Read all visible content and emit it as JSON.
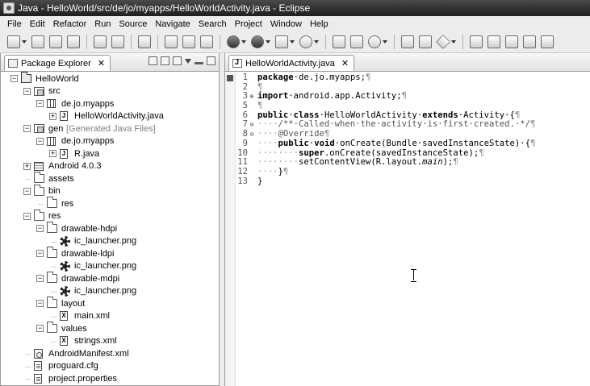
{
  "window": {
    "title": "Java - HelloWorld/src/de/jo/myapps/HelloWorldActivity.java - Eclipse"
  },
  "menu": [
    "File",
    "Edit",
    "Refactor",
    "Run",
    "Source",
    "Navigate",
    "Search",
    "Project",
    "Window",
    "Help"
  ],
  "package_explorer": {
    "tab_label": "Package Explorer",
    "close_glyph": "✕",
    "tree": [
      {
        "label": "HelloWorld",
        "suffix": "",
        "depth": 0,
        "exp": "open",
        "icon": "project"
      },
      {
        "label": "src",
        "suffix": "",
        "depth": 1,
        "exp": "open",
        "icon": "srcfolder"
      },
      {
        "label": "de.jo.myapps",
        "suffix": "",
        "depth": 2,
        "exp": "open",
        "icon": "package"
      },
      {
        "label": "HelloWorldActivity.java",
        "suffix": "",
        "depth": 3,
        "exp": "closed",
        "icon": "java"
      },
      {
        "label": "gen",
        "suffix": "[Generated Java Files]",
        "depth": 1,
        "exp": "open",
        "icon": "srcfolder"
      },
      {
        "label": "de.jo.myapps",
        "suffix": "",
        "depth": 2,
        "exp": "open",
        "icon": "package"
      },
      {
        "label": "R.java",
        "suffix": "",
        "depth": 3,
        "exp": "closed",
        "icon": "java"
      },
      {
        "label": "Android 4.0.3",
        "suffix": "",
        "depth": 1,
        "exp": "closed",
        "icon": "lib"
      },
      {
        "label": "assets",
        "suffix": "",
        "depth": 1,
        "exp": "none",
        "icon": "folder"
      },
      {
        "label": "bin",
        "suffix": "",
        "depth": 1,
        "exp": "open",
        "icon": "folder"
      },
      {
        "label": "res",
        "suffix": "",
        "depth": 2,
        "exp": "none",
        "icon": "folder"
      },
      {
        "label": "res",
        "suffix": "",
        "depth": 1,
        "exp": "open",
        "icon": "folder"
      },
      {
        "label": "drawable-hdpi",
        "suffix": "",
        "depth": 2,
        "exp": "open",
        "icon": "folder"
      },
      {
        "label": "ic_launcher.png",
        "suffix": "",
        "depth": 3,
        "exp": "none",
        "icon": "png"
      },
      {
        "label": "drawable-ldpi",
        "suffix": "",
        "depth": 2,
        "exp": "open",
        "icon": "folder"
      },
      {
        "label": "ic_launcher.png",
        "suffix": "",
        "depth": 3,
        "exp": "none",
        "icon": "png"
      },
      {
        "label": "drawable-mdpi",
        "suffix": "",
        "depth": 2,
        "exp": "open",
        "icon": "folder"
      },
      {
        "label": "ic_launcher.png",
        "suffix": "",
        "depth": 3,
        "exp": "none",
        "icon": "png"
      },
      {
        "label": "layout",
        "suffix": "",
        "depth": 2,
        "exp": "open",
        "icon": "folder"
      },
      {
        "label": "main.xml",
        "suffix": "",
        "depth": 3,
        "exp": "none",
        "icon": "xml"
      },
      {
        "label": "values",
        "suffix": "",
        "depth": 2,
        "exp": "open",
        "icon": "folder"
      },
      {
        "label": "strings.xml",
        "suffix": "",
        "depth": 3,
        "exp": "none",
        "icon": "xml"
      },
      {
        "label": "AndroidManifest.xml",
        "suffix": "",
        "depth": 1,
        "exp": "none",
        "icon": "manifest"
      },
      {
        "label": "proguard.cfg",
        "suffix": "",
        "depth": 1,
        "exp": "none",
        "icon": "file"
      },
      {
        "label": "project.properties",
        "suffix": "",
        "depth": 1,
        "exp": "none",
        "icon": "file"
      }
    ]
  },
  "editor": {
    "tab_label": "HelloWorldActivity.java",
    "close_glyph": "✕",
    "lines": [
      {
        "n": "1",
        "fold": "",
        "segs": [
          [
            "kw",
            "package"
          ],
          [
            "",
            "·de.jo.myapps;"
          ],
          [
            "ws",
            "¶"
          ]
        ]
      },
      {
        "n": "2",
        "fold": "",
        "segs": [
          [
            "ws",
            "¶"
          ]
        ]
      },
      {
        "n": "3",
        "fold": "⊕",
        "segs": [
          [
            "kw",
            "import"
          ],
          [
            "",
            "·android.app.Activity;"
          ],
          [
            "ws",
            "¶"
          ]
        ]
      },
      {
        "n": "5",
        "fold": "",
        "segs": [
          [
            "ws",
            "¶"
          ]
        ]
      },
      {
        "n": "6",
        "fold": "",
        "segs": [
          [
            "kw",
            "public"
          ],
          [
            "",
            "·"
          ],
          [
            "kw",
            "class"
          ],
          [
            "",
            "·HelloWorldActivity·"
          ],
          [
            "kw",
            "extends"
          ],
          [
            "",
            "·Activity·{"
          ],
          [
            "ws",
            "¶"
          ]
        ]
      },
      {
        "n": "7",
        "fold": "⊖",
        "segs": [
          [
            "ws",
            "····"
          ],
          [
            "cm",
            "/**·Called·when·the·activity·is·first·created.·*/"
          ],
          [
            "ws",
            "¶"
          ]
        ]
      },
      {
        "n": "8",
        "fold": "⊖",
        "segs": [
          [
            "ws",
            "····"
          ],
          [
            "cm",
            "@Override"
          ],
          [
            "ws",
            "¶"
          ]
        ]
      },
      {
        "n": "9",
        "fold": "",
        "segs": [
          [
            "ws",
            "····"
          ],
          [
            "kw",
            "public"
          ],
          [
            "",
            "·"
          ],
          [
            "kw",
            "void"
          ],
          [
            "",
            "·onCreate(Bundle·savedInstanceState)·{"
          ],
          [
            "ws",
            "¶"
          ]
        ]
      },
      {
        "n": "10",
        "fold": "",
        "segs": [
          [
            "ws",
            "········"
          ],
          [
            "kw",
            "super"
          ],
          [
            "",
            ".onCreate(savedInstanceState);"
          ],
          [
            "ws",
            "¶"
          ]
        ]
      },
      {
        "n": "11",
        "fold": "",
        "segs": [
          [
            "ws",
            "········"
          ],
          [
            "",
            "setContentView(R.layout."
          ],
          [
            "it",
            "main"
          ],
          [
            "",
            ");"
          ],
          [
            "ws",
            "¶"
          ]
        ]
      },
      {
        "n": "12",
        "fold": "",
        "segs": [
          [
            "ws",
            "····"
          ],
          [
            "",
            "}"
          ],
          [
            "ws",
            "¶"
          ]
        ]
      },
      {
        "n": "13",
        "fold": "",
        "segs": [
          [
            "",
            "}"
          ]
        ]
      }
    ]
  }
}
